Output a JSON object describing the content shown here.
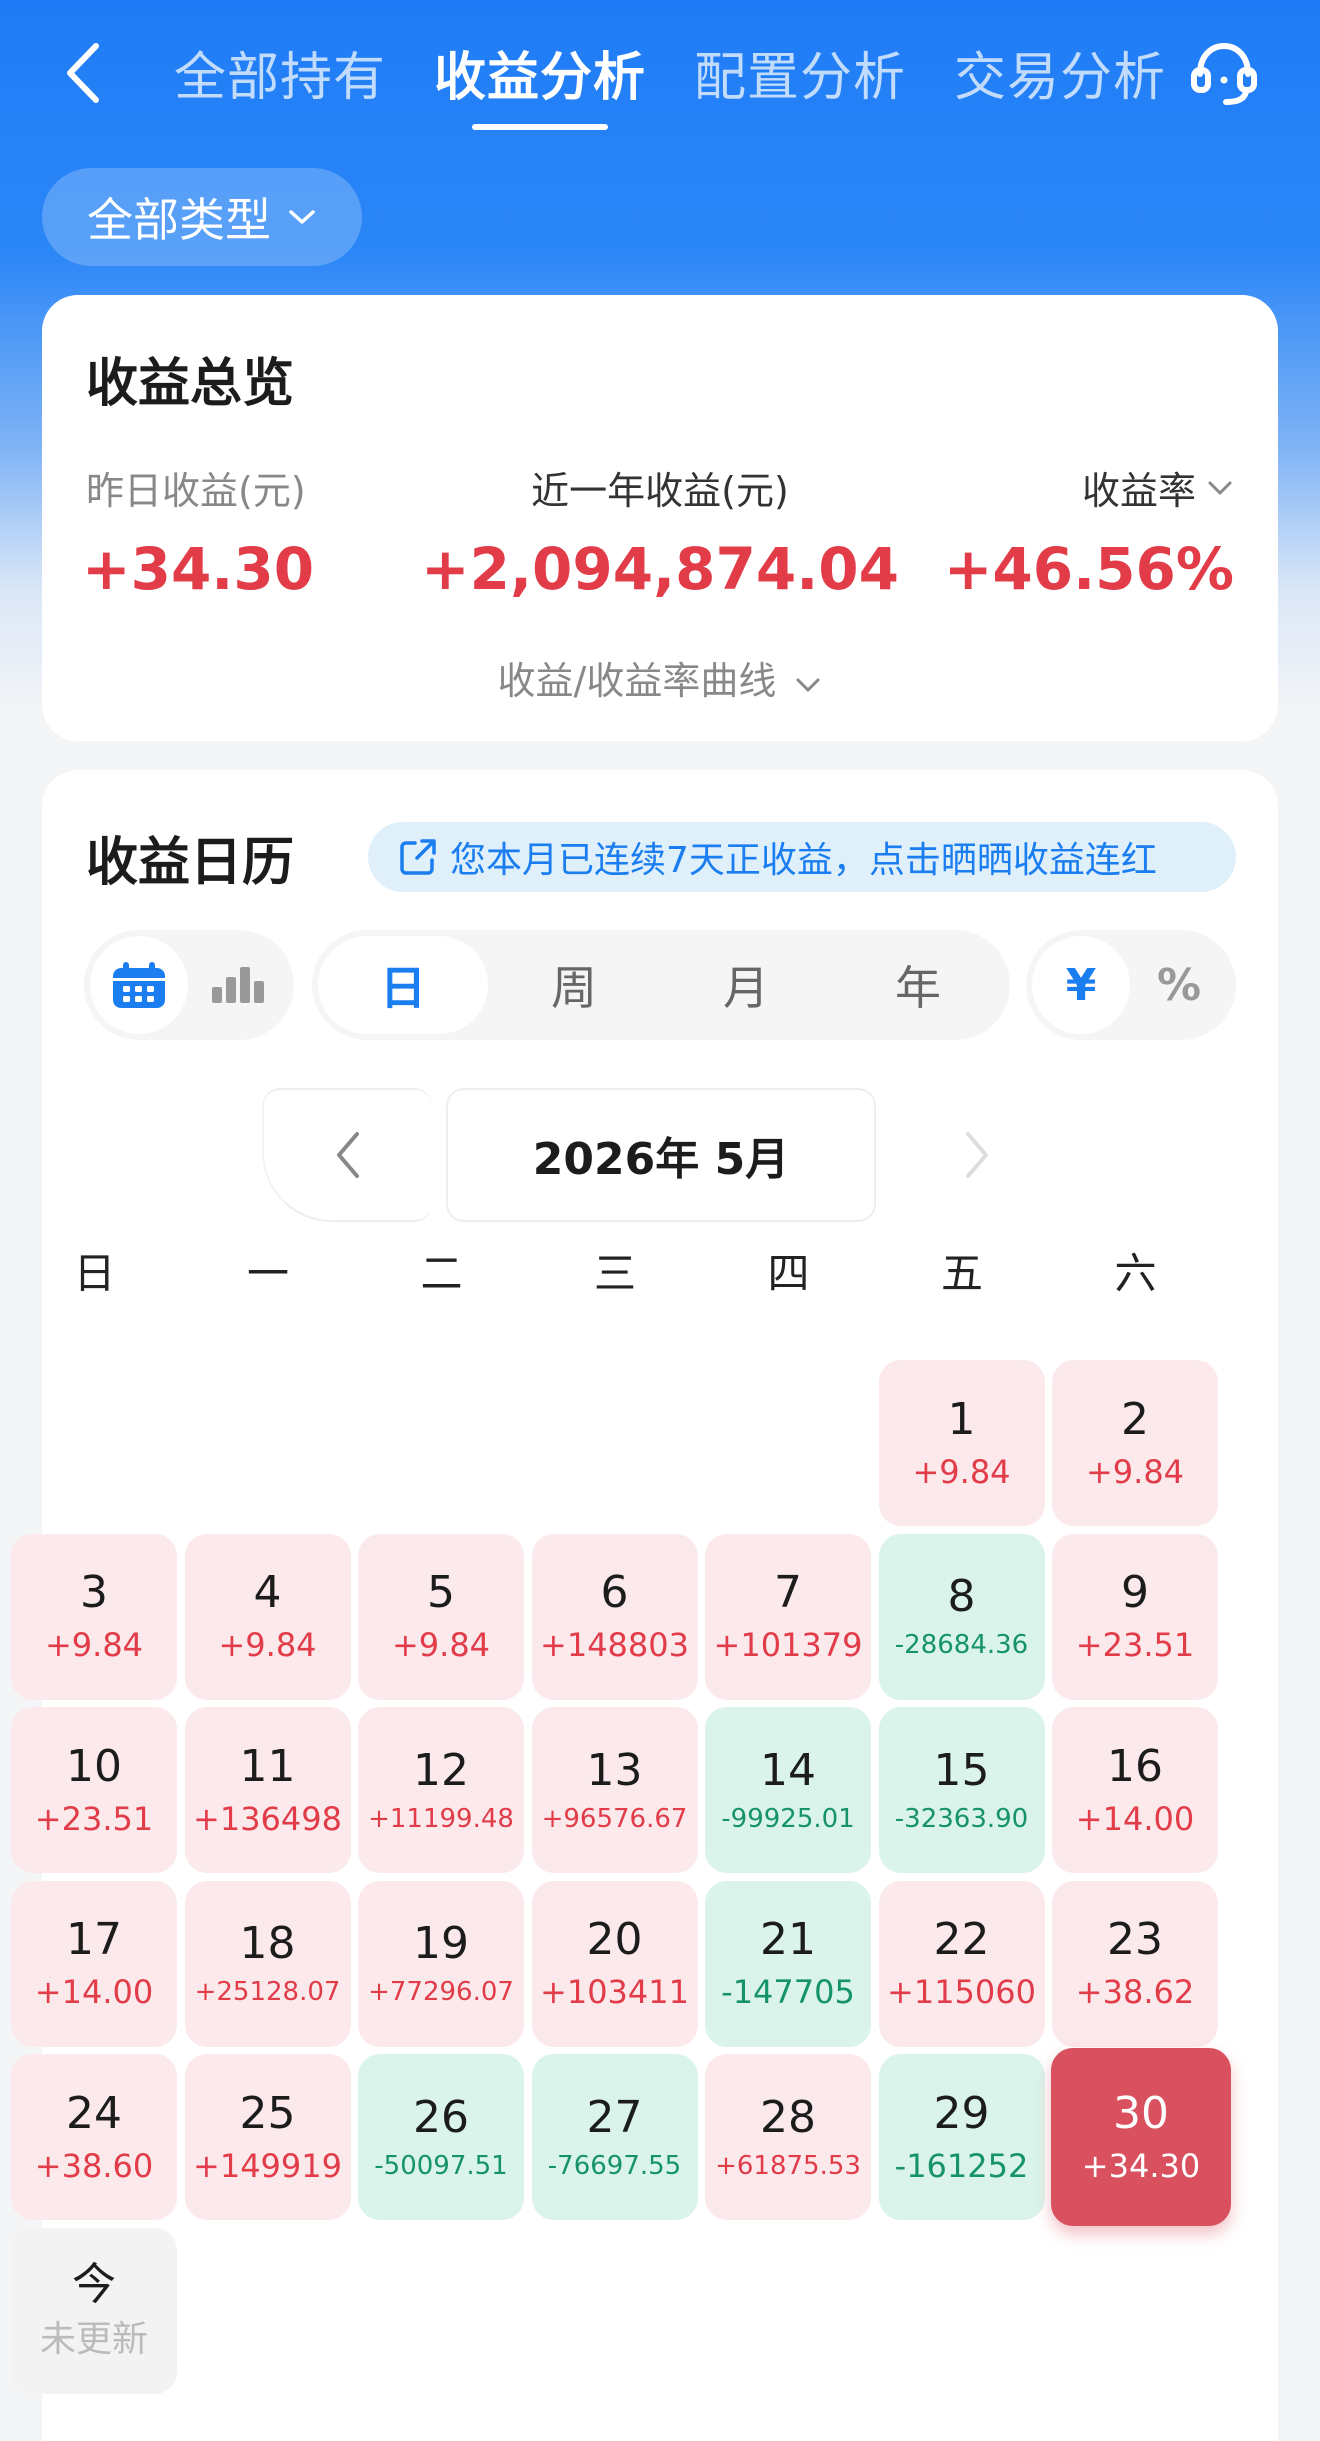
{
  "header": {
    "tabs": [
      "全部持有",
      "收益分析",
      "配置分析",
      "交易分析"
    ],
    "active_tab": 1
  },
  "filter": {
    "type_label": "全部类型"
  },
  "overview": {
    "title": "收益总览",
    "yesterday_label": "昨日收益(元)",
    "yesterday_value": "+34.30",
    "year_label": "近一年收益(元)",
    "year_value": "+2,094,874.04",
    "rate_label": "收益率",
    "rate_value": "+46.56%",
    "curve_label": "收益/收益率曲线"
  },
  "calendar": {
    "title": "收益日历",
    "promo_text": "您本月已连续7天正收益，点击晒晒收益连红",
    "periods": [
      "日",
      "周",
      "月",
      "年"
    ],
    "active_period": 0,
    "units": [
      "¥",
      "%"
    ],
    "active_unit": 0,
    "month_label": "2026年 5月",
    "weekdays": [
      "日",
      "一",
      "二",
      "三",
      "四",
      "五",
      "六"
    ],
    "first_weekday": 5,
    "days": [
      {
        "d": "1",
        "v": "+9.84",
        "t": "pos"
      },
      {
        "d": "2",
        "v": "+9.84",
        "t": "pos"
      },
      {
        "d": "3",
        "v": "+9.84",
        "t": "pos"
      },
      {
        "d": "4",
        "v": "+9.84",
        "t": "pos"
      },
      {
        "d": "5",
        "v": "+9.84",
        "t": "pos"
      },
      {
        "d": "6",
        "v": "+148803",
        "t": "pos"
      },
      {
        "d": "7",
        "v": "+101379",
        "t": "pos"
      },
      {
        "d": "8",
        "v": "-28684.36",
        "t": "neg"
      },
      {
        "d": "9",
        "v": "+23.51",
        "t": "pos"
      },
      {
        "d": "10",
        "v": "+23.51",
        "t": "pos"
      },
      {
        "d": "11",
        "v": "+136498",
        "t": "pos"
      },
      {
        "d": "12",
        "v": "+11199.48",
        "t": "pos"
      },
      {
        "d": "13",
        "v": "+96576.67",
        "t": "pos"
      },
      {
        "d": "14",
        "v": "-99925.01",
        "t": "neg"
      },
      {
        "d": "15",
        "v": "-32363.90",
        "t": "neg"
      },
      {
        "d": "16",
        "v": "+14.00",
        "t": "pos"
      },
      {
        "d": "17",
        "v": "+14.00",
        "t": "pos"
      },
      {
        "d": "18",
        "v": "+25128.07",
        "t": "pos"
      },
      {
        "d": "19",
        "v": "+77296.07",
        "t": "pos"
      },
      {
        "d": "20",
        "v": "+103411",
        "t": "pos"
      },
      {
        "d": "21",
        "v": "-147705",
        "t": "neg"
      },
      {
        "d": "22",
        "v": "+115060",
        "t": "pos"
      },
      {
        "d": "23",
        "v": "+38.62",
        "t": "pos"
      },
      {
        "d": "24",
        "v": "+38.60",
        "t": "pos"
      },
      {
        "d": "25",
        "v": "+149919",
        "t": "pos"
      },
      {
        "d": "26",
        "v": "-50097.51",
        "t": "neg"
      },
      {
        "d": "27",
        "v": "-76697.55",
        "t": "neg"
      },
      {
        "d": "28",
        "v": "+61875.53",
        "t": "pos"
      },
      {
        "d": "29",
        "v": "-161252",
        "t": "neg"
      },
      {
        "d": "30",
        "v": "+34.30",
        "t": "sel"
      },
      {
        "d": "今",
        "v": "未更新",
        "t": "today"
      }
    ]
  },
  "colors": {
    "primary": "#1a7df0",
    "positive": "#e23c49",
    "negative": "#17936c",
    "selected": "#d9515f"
  }
}
